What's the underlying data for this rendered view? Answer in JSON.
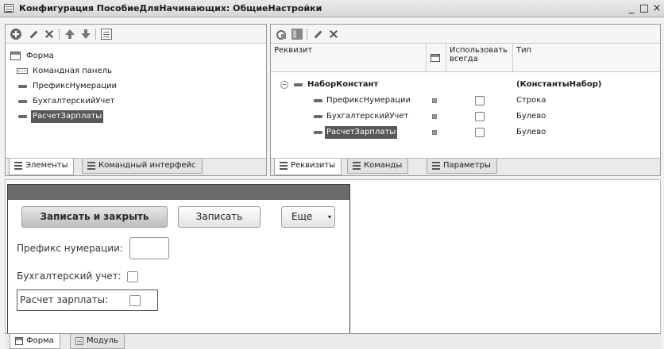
{
  "window": {
    "title": "Конфигурация ПособиеДляНачинающих: ОбщиеНастройки",
    "minimize": "_",
    "maximize": "□",
    "close": "×"
  },
  "elements_panel": {
    "tree": [
      {
        "label": "Форма",
        "icon": "form-icon"
      },
      {
        "label": "Командная панель",
        "icon": "command-panel-icon"
      },
      {
        "label": "ПрефиксНумерации",
        "icon": "field-icon"
      },
      {
        "label": "БухгалтерскийУчет",
        "icon": "field-icon"
      },
      {
        "label": "РасчетЗарплаты",
        "icon": "field-icon",
        "selected": true
      }
    ],
    "tabs": [
      "Элементы",
      "Командный интерфейс"
    ]
  },
  "attributes_panel": {
    "columns": {
      "attribute": "Реквизит",
      "always_use": "Использовать всегда",
      "type": "Тип"
    },
    "rows": [
      {
        "name": "НаборКонстант",
        "type": "(КонстантыНабор)",
        "bold": true
      },
      {
        "name": "ПрефиксНумерации",
        "type": "Строка"
      },
      {
        "name": "БухгалтерскийУчет",
        "type": "Булево"
      },
      {
        "name": "РасчетЗарплаты",
        "type": "Булево",
        "selected": true
      }
    ],
    "tabs": [
      "Реквизиты",
      "Команды",
      "Параметры"
    ]
  },
  "form_preview": {
    "save_close_button": "Записать и закрыть",
    "save_button": "Записать",
    "more_button": "Еще",
    "more_arrow": "▾",
    "fields": {
      "prefix": "Префикс нумерации:",
      "accounting": "Бухгалтерский учет:",
      "payroll": "Расчет зарплаты:"
    }
  },
  "bottom_tabs": [
    "Форма",
    "Модуль"
  ]
}
